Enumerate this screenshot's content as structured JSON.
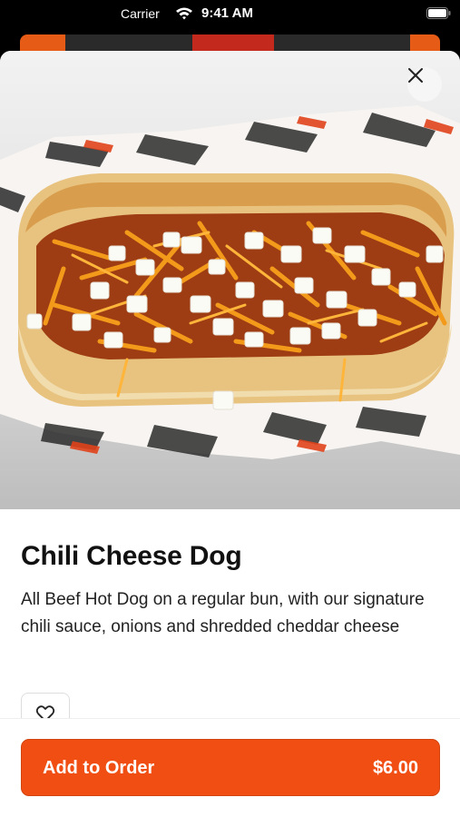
{
  "status_bar": {
    "carrier": "Carrier",
    "time": "9:41 AM"
  },
  "product": {
    "image_alt": "Chili Cheese Dog photo",
    "title": "Chili Cheese Dog",
    "description": "All Beef Hot Dog on a regular bun, with our signature chili sauce, onions and shredded cheddar cheese"
  },
  "actions": {
    "add_label": "Add to Order",
    "price": "$6.00"
  },
  "icons": {
    "close": "close-icon",
    "favorite": "heart-icon",
    "wifi": "wifi-icon",
    "battery": "battery-icon"
  },
  "colors": {
    "accent": "#F04E12",
    "text": "#111111"
  }
}
